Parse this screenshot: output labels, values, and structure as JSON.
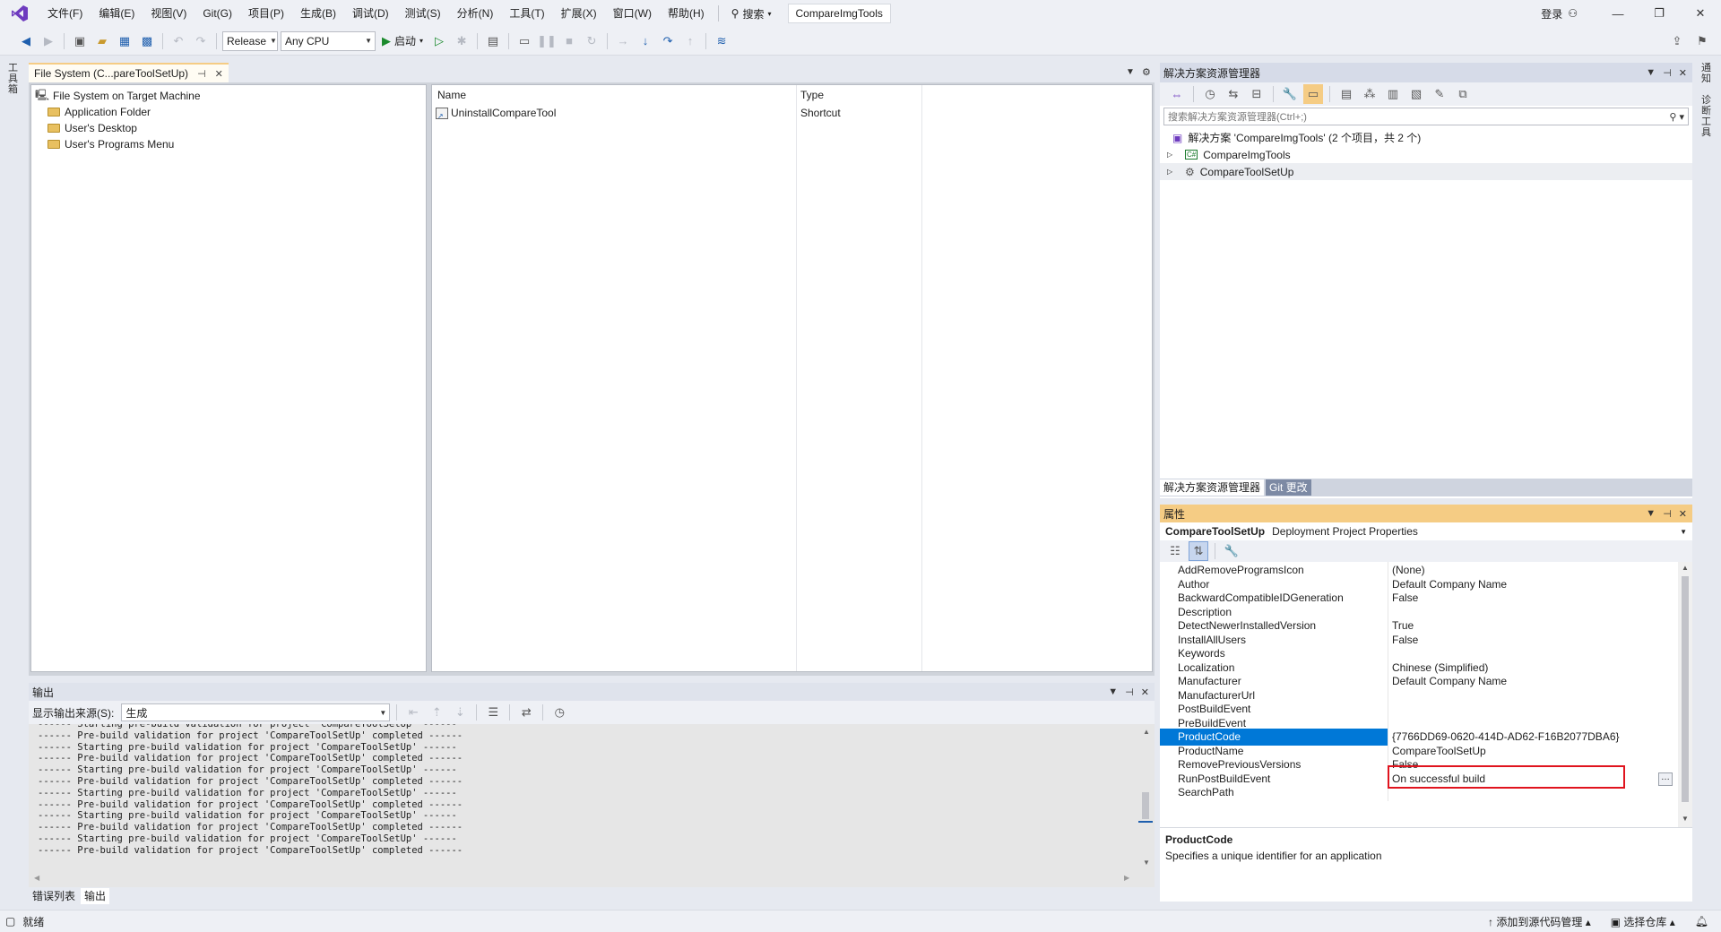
{
  "menu": {
    "items": [
      "文件(F)",
      "编辑(E)",
      "视图(V)",
      "Git(G)",
      "项目(P)",
      "生成(B)",
      "调试(D)",
      "测试(S)",
      "分析(N)",
      "工具(T)",
      "扩展(X)",
      "窗口(W)",
      "帮助(H)"
    ],
    "search_label": "搜索",
    "solution_name": "CompareImgTools",
    "login_label": "登录"
  },
  "toolbar": {
    "configuration": "Release",
    "platform": "Any CPU",
    "start_label": "启动"
  },
  "side_tabs": {
    "left": "工具箱",
    "right_top": "通知",
    "right_bottom": "诊断工具"
  },
  "document": {
    "tab_title": "File System (C...pareToolSetUp)",
    "tree": {
      "root": "File System on Target Machine",
      "children": [
        "Application Folder",
        "User's Desktop",
        "User's Programs Menu"
      ]
    },
    "list": {
      "columns": [
        "Name",
        "Type"
      ],
      "rows": [
        {
          "name": "UninstallCompareTool",
          "type": "Shortcut"
        }
      ]
    }
  },
  "output": {
    "title": "输出",
    "source_label": "显示输出来源(S):",
    "source_value": "生成",
    "lines": [
      "------ Starting pre-build validation for project 'CompareToolSetUp' ------",
      "------ Pre-build validation for project 'CompareToolSetUp' completed ------",
      "------ Starting pre-build validation for project 'CompareToolSetUp' ------",
      "------ Pre-build validation for project 'CompareToolSetUp' completed ------",
      "------ Starting pre-build validation for project 'CompareToolSetUp' ------",
      "------ Pre-build validation for project 'CompareToolSetUp' completed ------",
      "------ Starting pre-build validation for project 'CompareToolSetUp' ------",
      "------ Pre-build validation for project 'CompareToolSetUp' completed ------",
      "------ Starting pre-build validation for project 'CompareToolSetUp' ------",
      "------ Pre-build validation for project 'CompareToolSetUp' completed ------",
      "------ Starting pre-build validation for project 'CompareToolSetUp' ------",
      "------ Pre-build validation for project 'CompareToolSetUp' completed ------"
    ],
    "tabs": [
      "错误列表",
      "输出"
    ]
  },
  "solution_explorer": {
    "title": "解决方案资源管理器",
    "search_placeholder": "搜索解决方案资源管理器(Ctrl+;)",
    "solution_label": "解决方案 'CompareImgTools' (2 个项目，共 2 个)",
    "projects": [
      "CompareImgTools",
      "CompareToolSetUp"
    ],
    "bottom_tabs": [
      "解决方案资源管理器",
      "Git 更改"
    ]
  },
  "properties": {
    "title": "属性",
    "object_name": "CompareToolSetUp",
    "object_type": "Deployment Project Properties",
    "rows": [
      {
        "name": "AddRemoveProgramsIcon",
        "value": "(None)"
      },
      {
        "name": "Author",
        "value": "Default Company Name"
      },
      {
        "name": "BackwardCompatibleIDGeneration",
        "value": "False"
      },
      {
        "name": "Description",
        "value": ""
      },
      {
        "name": "DetectNewerInstalledVersion",
        "value": "True"
      },
      {
        "name": "InstallAllUsers",
        "value": "False"
      },
      {
        "name": "Keywords",
        "value": ""
      },
      {
        "name": "Localization",
        "value": "Chinese (Simplified)"
      },
      {
        "name": "Manufacturer",
        "value": "Default Company Name"
      },
      {
        "name": "ManufacturerUrl",
        "value": ""
      },
      {
        "name": "PostBuildEvent",
        "value": ""
      },
      {
        "name": "PreBuildEvent",
        "value": ""
      },
      {
        "name": "ProductCode",
        "value": "{7766DD69-0620-414D-AD62-F16B2077DBA6}"
      },
      {
        "name": "ProductName",
        "value": "CompareToolSetUp"
      },
      {
        "name": "RemovePreviousVersions",
        "value": "False"
      },
      {
        "name": "RunPostBuildEvent",
        "value": "On successful build"
      },
      {
        "name": "SearchPath",
        "value": ""
      }
    ],
    "selected_index": 12,
    "description_name": "ProductCode",
    "description_text": "Specifies a unique identifier for an application"
  },
  "status": {
    "ready": "就绪",
    "add_to_source": "添加到源代码管理",
    "select_repo": "选择仓库"
  },
  "colors": {
    "accent": "#0078d7",
    "highlight_box": "#e0141e",
    "active_tab": "#f5cc84",
    "vs_purple": "#6e3bbf"
  }
}
